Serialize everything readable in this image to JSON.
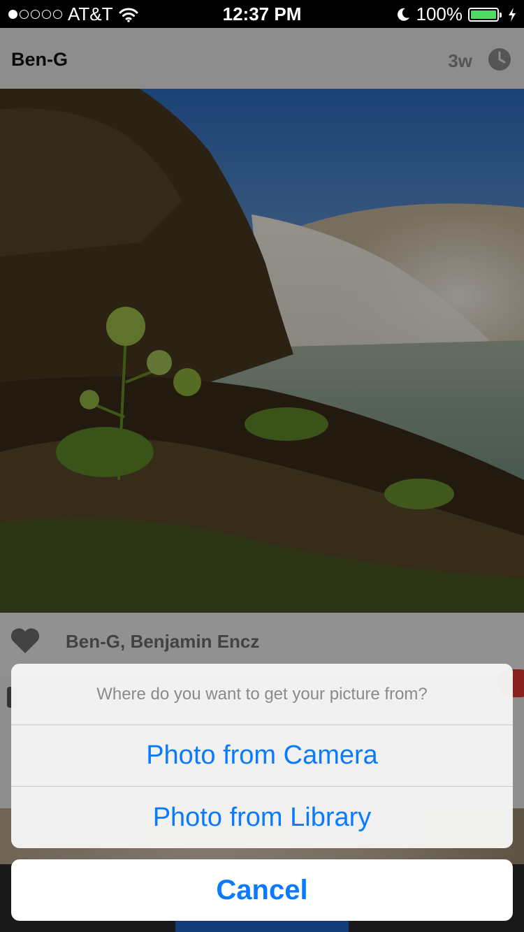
{
  "status_bar": {
    "carrier": "AT&T",
    "time": "12:37 PM",
    "battery": "100%",
    "battery_level": 1.0,
    "signal_dots_filled": 1,
    "signal_dots_total": 5
  },
  "post": {
    "username": "Ben-G",
    "age": "3w",
    "likes": "Ben-G, Benjamin Encz"
  },
  "action_sheet": {
    "title": "Where do you want to get your picture from?",
    "options": [
      {
        "label": "Photo from Camera"
      },
      {
        "label": "Photo from Library"
      }
    ],
    "cancel": "Cancel"
  },
  "colors": {
    "accent": "#0a7aff",
    "battery": "#4cd964",
    "badge": "#e53935",
    "tab_active": "#1e63c9"
  },
  "icons": {
    "wifi": "wifi-icon",
    "moon": "moon-icon",
    "charging": "bolt-icon",
    "clock": "clock-icon",
    "heart": "heart-icon"
  }
}
